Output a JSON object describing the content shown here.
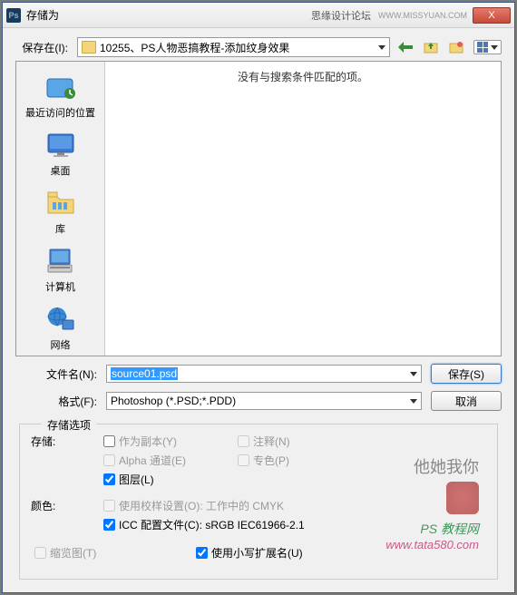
{
  "titlebar": {
    "app_icon": "Ps",
    "title": "存储为",
    "right_text": "思缘设计论坛",
    "url_badge": "WWW.MISSYUAN.COM",
    "close": "X"
  },
  "savein": {
    "label": "保存在(I):",
    "folder": "10255、PS人物恶搞教程-添加纹身效果"
  },
  "sidebar": {
    "items": [
      {
        "label": "最近访问的位置"
      },
      {
        "label": "桌面"
      },
      {
        "label": "库"
      },
      {
        "label": "计算机"
      },
      {
        "label": "网络"
      }
    ]
  },
  "filelist": {
    "empty": "没有与搜索条件匹配的项。"
  },
  "filename": {
    "label": "文件名(N):",
    "value": "source01.psd"
  },
  "format": {
    "label": "格式(F):",
    "value": "Photoshop (*.PSD;*.PDD)"
  },
  "buttons": {
    "save": "保存(S)",
    "cancel": "取消"
  },
  "options": {
    "title": "存储选项",
    "storage_label": "存储:",
    "checks": {
      "as_copy": "作为副本(Y)",
      "notes": "注释(N)",
      "alpha": "Alpha 通道(E)",
      "spot": "专色(P)",
      "layers": "图层(L)"
    },
    "color_label": "颜色:",
    "color_checks": {
      "proof": "使用校样设置(O): 工作中的 CMYK",
      "icc": "ICC 配置文件(C): sRGB IEC61966-2.1"
    },
    "thumbnail": "缩览图(T)",
    "lowercase": "使用小写扩展名(U)"
  },
  "watermark": {
    "chinese": "他她我你",
    "line1": "PS 教程网",
    "line2": "www.tata580.com"
  }
}
